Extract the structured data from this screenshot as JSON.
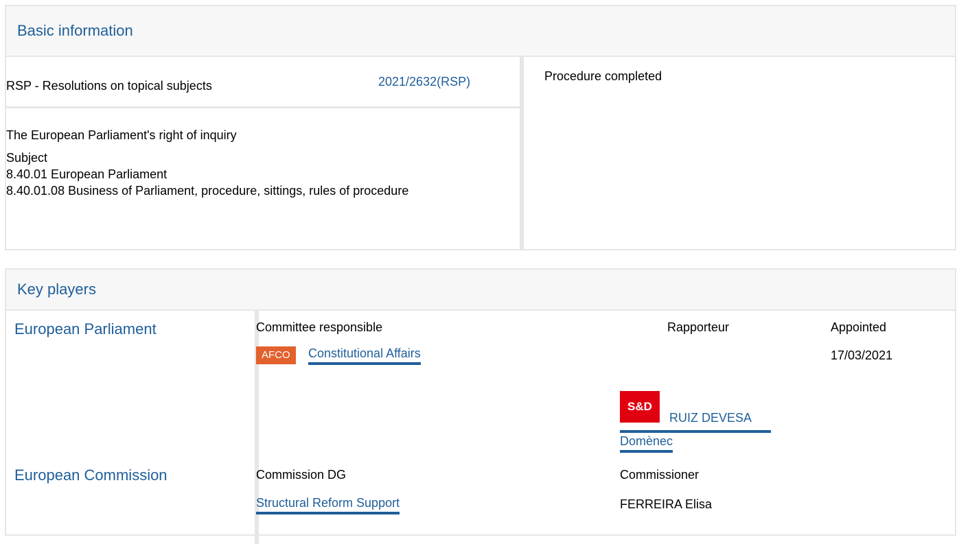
{
  "basic": {
    "header": "Basic information",
    "procedure_type": "RSP - Resolutions on topical subjects",
    "reference": "2021/2632(RSP)",
    "status": "Procedure completed",
    "title": "The European Parliament's right of inquiry",
    "subject_label": "Subject",
    "subjects": [
      "8.40.01 European Parliament",
      "8.40.01.08 Business of Parliament, procedure, sittings, rules of procedure"
    ]
  },
  "players": {
    "header": "Key players",
    "ep": {
      "institution": "European Parliament",
      "col_committee": "Committee responsible",
      "col_rapporteur": "Rapporteur",
      "col_appointed": "Appointed",
      "committee_code": "AFCO",
      "committee_name": "Constitutional Affairs",
      "appointed_date": "17/03/2021",
      "party_logo": "S&D",
      "rapporteur_line1": "RUIZ DEVESA",
      "rapporteur_line2": "Domènec"
    },
    "ec": {
      "institution": "European Commission",
      "col_dg": "Commission DG",
      "col_commissioner": "Commissioner",
      "dg_name": "Structural Reform Support",
      "commissioner": "FERREIRA Elisa"
    }
  },
  "colors": {
    "link": "#1f5e9a",
    "badge": "#e2612d",
    "party": "#e1000f",
    "border": "#e6e6e6"
  }
}
